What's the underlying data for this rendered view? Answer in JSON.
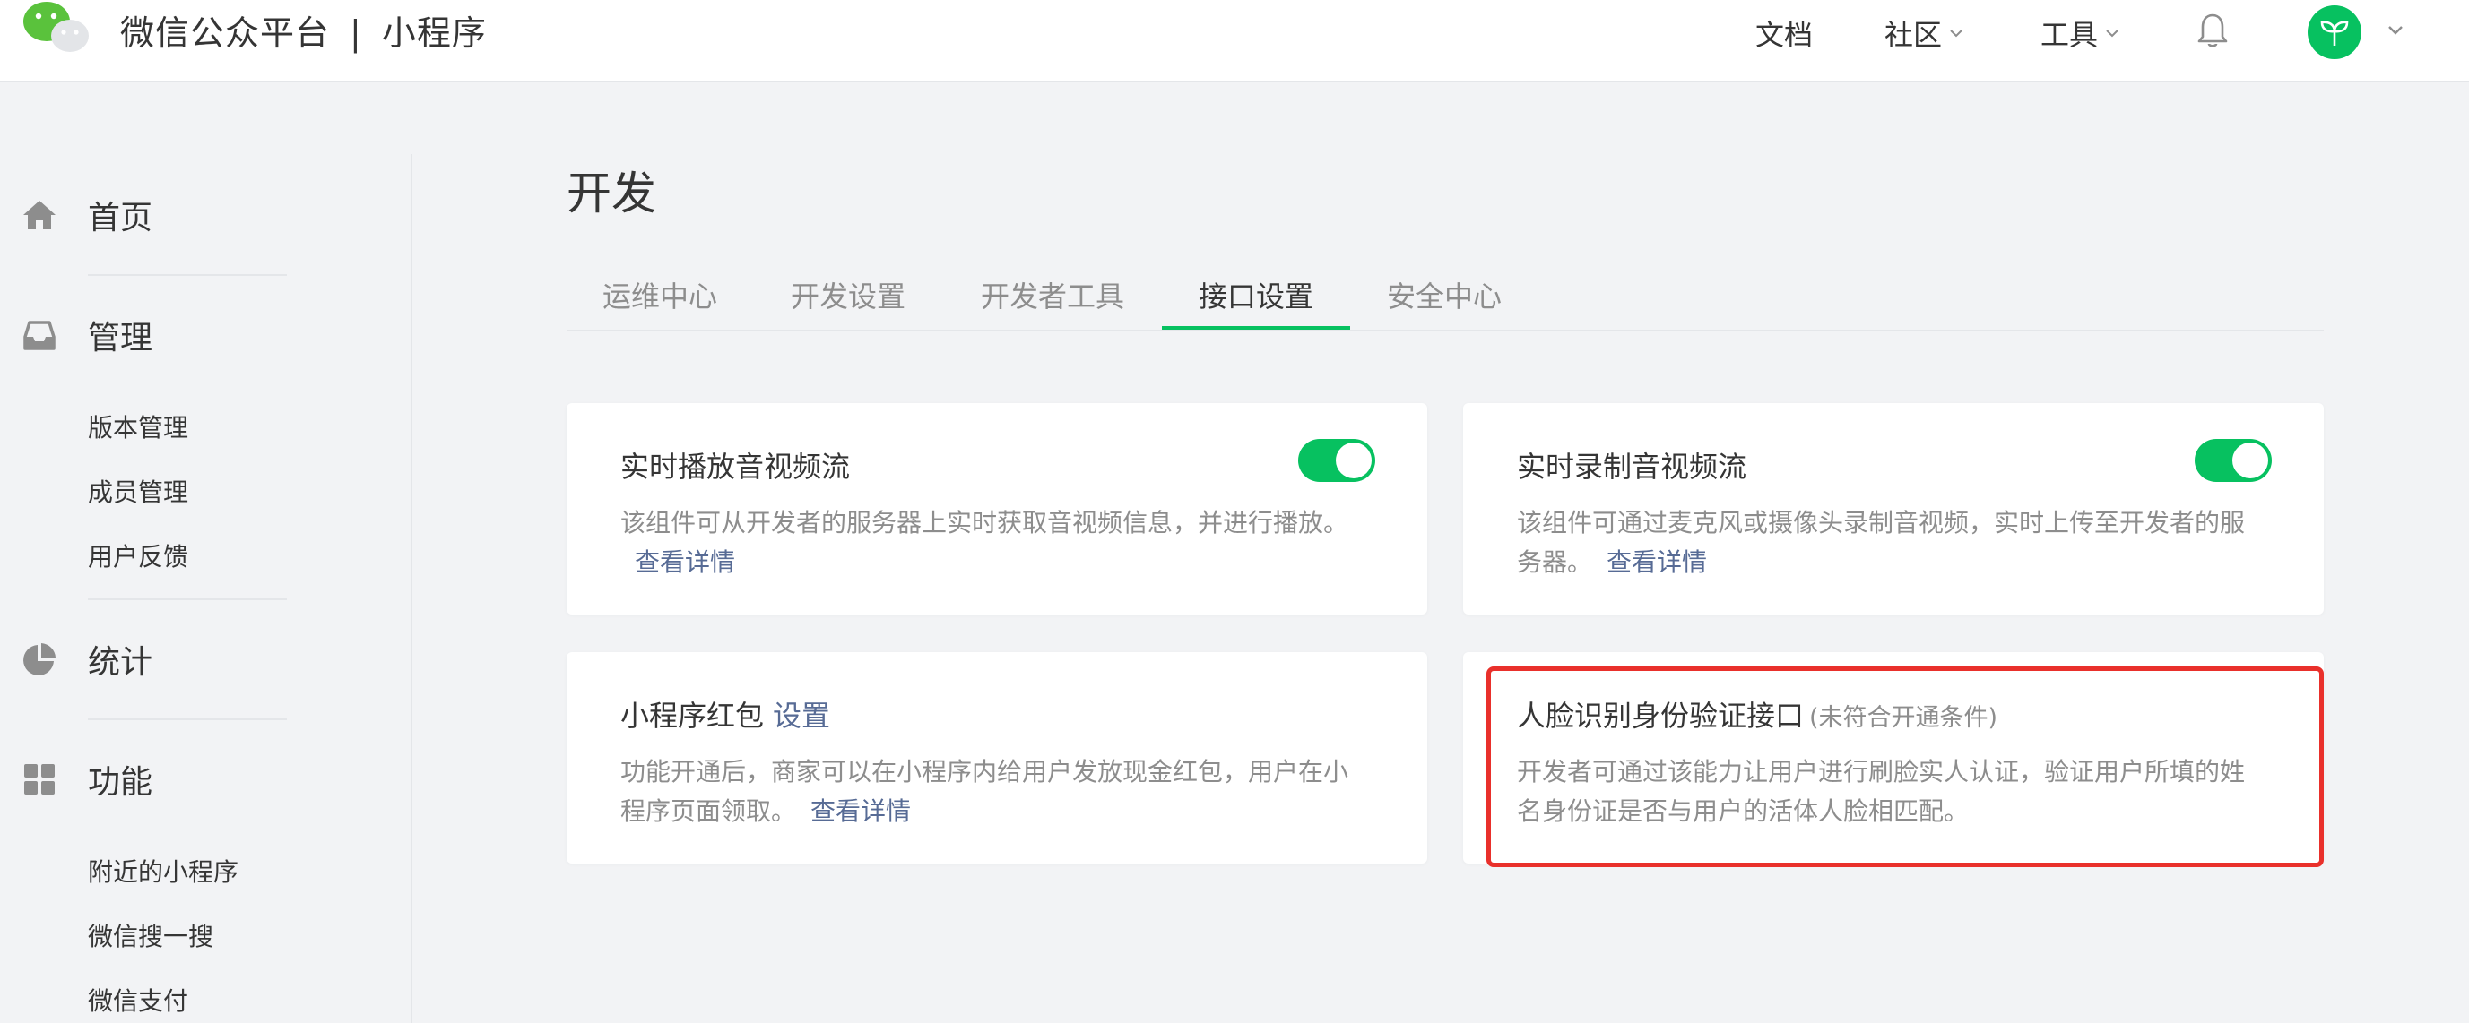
{
  "header": {
    "brand_main": "微信公众平台",
    "brand_separator": "|",
    "brand_sub": "小程序",
    "nav": {
      "docs": "文档",
      "community": "社区",
      "tools": "工具"
    },
    "icons": [
      "wechat-logo-icon",
      "chevron-down-icon",
      "bell-icon",
      "sprout-avatar-icon"
    ],
    "accent_color": "#07c160"
  },
  "sidebar": {
    "home": "首页",
    "manage": {
      "label": "管理",
      "items": [
        "版本管理",
        "成员管理",
        "用户反馈"
      ]
    },
    "stats": "统计",
    "features": {
      "label": "功能",
      "items": [
        "附近的小程序",
        "微信搜一搜",
        "微信支付"
      ]
    }
  },
  "main": {
    "title": "开发",
    "tabs": [
      "运维中心",
      "开发设置",
      "开发者工具",
      "接口设置",
      "安全中心"
    ],
    "active_tab": "接口设置",
    "cards": {
      "live_play": {
        "title": "实时播放音视频流",
        "desc": "该组件可从开发者的服务器上实时获取音视频信息，并进行播放。",
        "link": "查看详情",
        "enabled": true
      },
      "live_record": {
        "title": "实时录制音视频流",
        "desc": "该组件可通过麦克风或摄像头录制音视频，实时上传至开发者的服务器。",
        "link": "查看详情",
        "enabled": true
      },
      "red_packet": {
        "title": "小程序红包",
        "title_link": "设置",
        "desc": "功能开通后，商家可以在小程序内给用户发放现金红包，用户在小程序页面领取。",
        "link": "查看详情"
      },
      "face_verify": {
        "title": "人脸识别身份验证接口",
        "status": "(未符合开通条件)",
        "desc": "开发者可通过该能力让用户进行刷脸实人认证，验证用户所填的姓名身份证是否与用户的活体人脸相匹配。"
      }
    },
    "highlight_color": "#e9302b",
    "link_color": "#576b95"
  }
}
